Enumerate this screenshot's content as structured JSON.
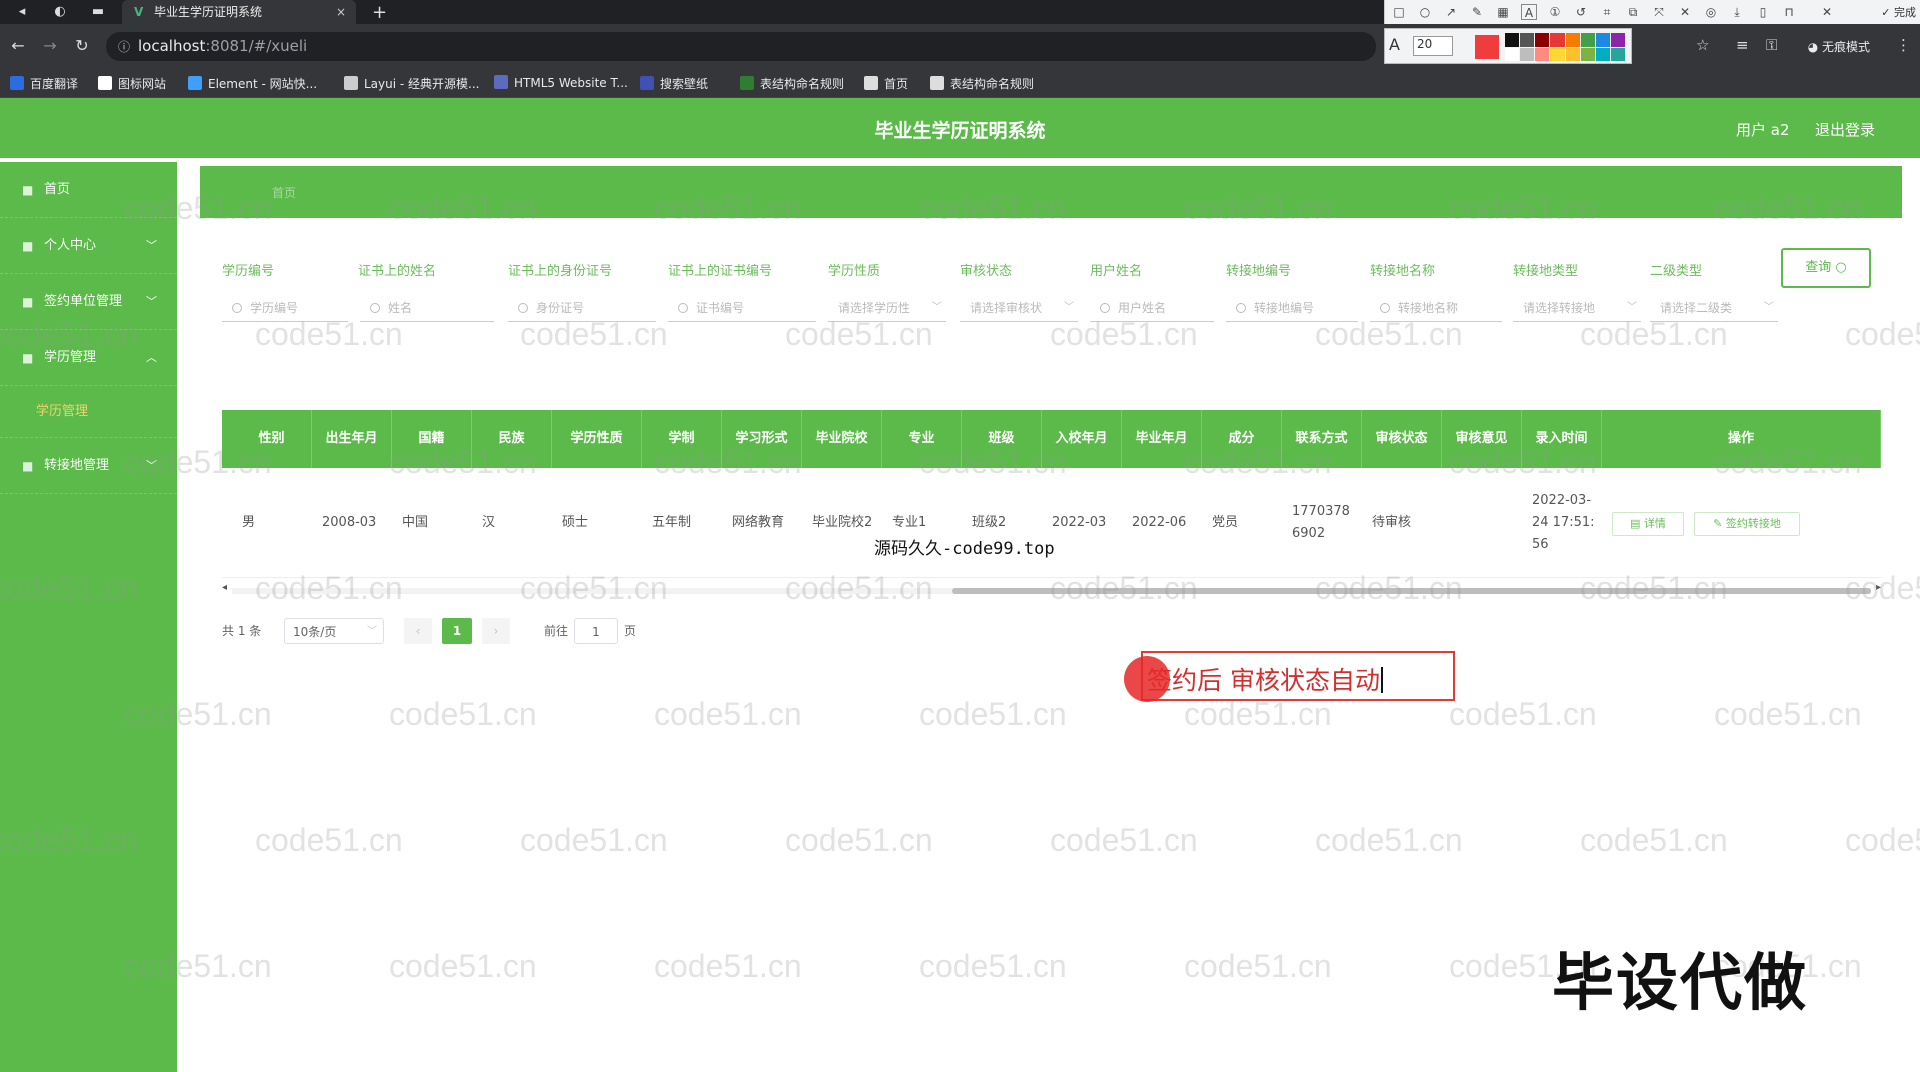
{
  "browser": {
    "tab_title": "毕业生学历证明系统",
    "tab_close": "×",
    "new_tab": "+",
    "url_host": "localhost",
    "url_rest": ":8081/#/xueli",
    "incognito_label": "无痕模式",
    "annot_tool_done": "完成",
    "annot_font_size": "20",
    "annot_palette": [
      "#111111",
      "#555555",
      "#8b0000",
      "#e53935",
      "#f57c00",
      "#43a047",
      "#1e88e5",
      "#8e24aa",
      "#ffffff",
      "#bdbdbd",
      "#ff8a80",
      "#fdd835",
      "#fbc02d",
      "#7cb342",
      "#00acc1",
      "#26a69a"
    ],
    "bookmarks": [
      {
        "label": "百度翻译",
        "color": "#2b6de0"
      },
      {
        "label": "图标网站",
        "color": "#ffffff"
      },
      {
        "label": "Element - 网站快...",
        "color": "#409eff"
      },
      {
        "label": "Layui - 经典开源模...",
        "color": "#cccccc"
      },
      {
        "label": "HTML5 Website T...",
        "color": "#5c6bc0"
      },
      {
        "label": "搜索壁纸",
        "color": "#3f51b5"
      },
      {
        "label": "表结构命名规则",
        "color": "#2e7d32"
      },
      {
        "label": "首页",
        "color": "#dddddd"
      },
      {
        "label": "表结构命名规则",
        "color": "#dddddd"
      }
    ]
  },
  "app": {
    "title": "毕业生学历证明系统",
    "user": "用户 a2",
    "logout": "退出登录",
    "accent": "#5bba4a"
  },
  "sidebar": {
    "items": [
      {
        "label": "首页",
        "has_children": false
      },
      {
        "label": "个人中心",
        "has_children": true
      },
      {
        "label": "签约单位管理",
        "has_children": true
      },
      {
        "label": "学历管理",
        "has_children": true,
        "expanded": true
      },
      {
        "label": "转接地管理",
        "has_children": true
      }
    ],
    "submenu_active": "学历管理"
  },
  "breadcrumb": "首页",
  "filters": {
    "labels": [
      "学历编号",
      "证书上的姓名",
      "证书上的身份证号",
      "证书上的证书编号",
      "学历性质",
      "审核状态",
      "用户姓名",
      "转接地编号",
      "转接地名称",
      "转接地类型",
      "二级类型"
    ],
    "placeholders": [
      "学历编号",
      "姓名",
      "身份证号",
      "证书编号",
      "请选择学历性",
      "请选择审核状",
      "用户姓名",
      "转接地编号",
      "转接地名称",
      "请选择转接地",
      "请选择二级类"
    ],
    "query_button": "查询"
  },
  "table": {
    "headers": [
      "性别",
      "出生年月",
      "国籍",
      "民族",
      "学历性质",
      "学制",
      "学习形式",
      "毕业院校",
      "专业",
      "班级",
      "入校年月",
      "毕业年月",
      "成分",
      "联系方式",
      "审核状态",
      "审核意见",
      "录入时间",
      "操作"
    ],
    "row": {
      "cells": [
        "男",
        "2008-03",
        "中国",
        "汉",
        "硕士",
        "五年制",
        "网络教育",
        "毕业院校2",
        "专业1",
        "班级2",
        "2022-03",
        "2022-06",
        "党员",
        "17703786902",
        "待审核",
        "",
        "2022-03-24 17:51:56"
      ],
      "actions": [
        "详情",
        "签约转接地"
      ]
    }
  },
  "pagination": {
    "total": "共 1 条",
    "page_size": "10条/页",
    "prev": "‹",
    "current": "1",
    "next": "›",
    "goto_label": "前往",
    "goto_value": "1",
    "page_unit": "页"
  },
  "overlays": {
    "caption": "源码久久-code99.top",
    "annotation_text": "签约后 审核状态自动",
    "watermark_big": "毕设代做",
    "watermark_text": "code51.cn"
  }
}
